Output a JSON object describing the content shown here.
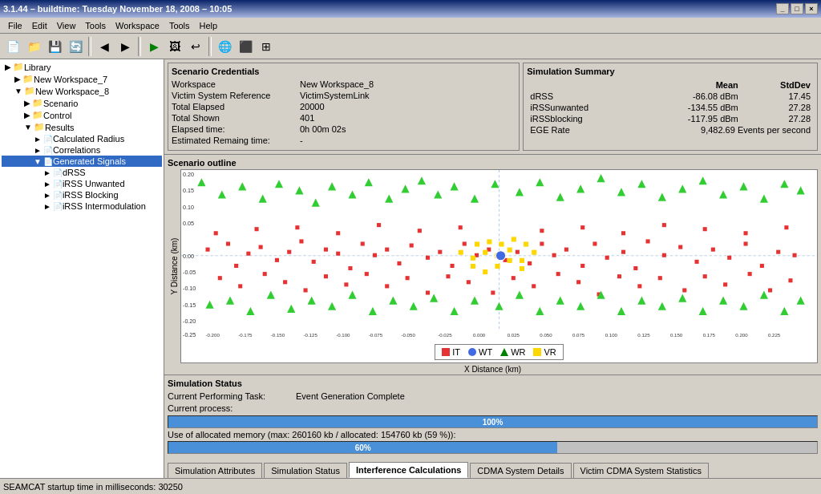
{
  "title_bar": {
    "text": "3.1.44 – buildtime: Tuesday November 18, 2008 – 10:05",
    "buttons": [
      "_",
      "□",
      "×"
    ]
  },
  "menu": {
    "items": [
      "File",
      "Edit",
      "View",
      "Tools",
      "Workspace",
      "Tools",
      "Help"
    ]
  },
  "sidebar": {
    "items": [
      {
        "label": "Library",
        "indent": 1,
        "icon": "▶",
        "type": "folder"
      },
      {
        "label": "New Workspace_7",
        "indent": 2,
        "icon": "▶",
        "type": "folder"
      },
      {
        "label": "New Workspace_8",
        "indent": 2,
        "icon": "▼",
        "type": "folder"
      },
      {
        "label": "Scenario",
        "indent": 3,
        "icon": "▶",
        "type": "folder"
      },
      {
        "label": "Control",
        "indent": 3,
        "icon": "▶",
        "type": "folder"
      },
      {
        "label": "Results",
        "indent": 3,
        "icon": "▼",
        "type": "folder"
      },
      {
        "label": "Calculated Radius",
        "indent": 4,
        "icon": "►",
        "type": "doc"
      },
      {
        "label": "Correlations",
        "indent": 4,
        "icon": "►",
        "type": "doc"
      },
      {
        "label": "Generated Signals",
        "indent": 4,
        "icon": "▼",
        "type": "doc"
      },
      {
        "label": "dRSS",
        "indent": 5,
        "icon": "►",
        "type": "doc"
      },
      {
        "label": "iRSS Unwanted",
        "indent": 5,
        "icon": "►",
        "type": "doc"
      },
      {
        "label": "iRSS Blocking",
        "indent": 5,
        "icon": "►",
        "type": "doc"
      },
      {
        "label": "iRSS Intermodulation",
        "indent": 5,
        "icon": "►",
        "type": "doc"
      }
    ]
  },
  "scenario_credentials": {
    "title": "Scenario Credentials",
    "rows": [
      {
        "label": "Workspace",
        "value": "New Workspace_8"
      },
      {
        "label": "Victim System Reference",
        "value": "VictimSystemLink"
      },
      {
        "label": "Total Elapsed",
        "value": "20000"
      },
      {
        "label": "Total Shown",
        "value": "401"
      },
      {
        "label": "Elapsed time:",
        "value": "0h 00m 02s"
      },
      {
        "label": "Estimated Remaing time:",
        "value": "-"
      }
    ]
  },
  "simulation_summary": {
    "title": "Simulation Summary",
    "headers": [
      "",
      "Mean",
      "StdDev"
    ],
    "rows": [
      {
        "label": "dRSS",
        "mean": "-86.08 dBm",
        "stddev": "17.45"
      },
      {
        "label": "iRSSunwanted",
        "mean": "-134.55 dBm",
        "stddev": "27.28"
      },
      {
        "label": "iRSSblocking",
        "mean": "-117.95 dBm",
        "stddev": "27.28"
      },
      {
        "label": "EGE Rate",
        "mean": "9,482.69 Events per second",
        "stddev": ""
      }
    ]
  },
  "scenario_outline": {
    "title": "Scenario outline",
    "x_label": "X Distance (km)",
    "y_label": "Y Distance (km)",
    "x_ticks": [
      "-0.200",
      "-0.175",
      "-0.150",
      "-0.125",
      "-0.100",
      "-0.075",
      "-0.050",
      "-0.025",
      "0.000",
      "0.025",
      "0.050",
      "0.075",
      "0.100",
      "0.125",
      "0.150",
      "0.175",
      "0.200",
      "0.225"
    ],
    "y_ticks": [
      "0.20",
      "0.15",
      "0.10",
      "0.05",
      "0.00",
      "-0.05",
      "-0.10",
      "-0.15",
      "-0.20",
      "-0.25"
    ],
    "legend": [
      {
        "symbol": "square",
        "color": "#e63232",
        "label": "IT"
      },
      {
        "symbol": "circle",
        "color": "#4169e1",
        "label": "WT"
      },
      {
        "symbol": "triangle",
        "color": "#32cd32",
        "label": "WR"
      },
      {
        "symbol": "square",
        "color": "#ffd700",
        "label": "VR"
      }
    ]
  },
  "simulation_status": {
    "title": "Simulation Status",
    "task_label": "Current Performing Task:",
    "task_value": "Event Generation Complete",
    "process_label": "Current process:",
    "progress1": {
      "label": "",
      "value": 100,
      "text": "100%"
    },
    "progress2_label": "Use of allocated memory (max: 260160 kb / allocated: 154760 kb (59 %)):",
    "progress2": {
      "value": 60,
      "text": "60%"
    }
  },
  "tabs": [
    {
      "label": "Simulation Attributes",
      "active": false
    },
    {
      "label": "Simulation Status",
      "active": false
    },
    {
      "label": "Interference Calculations",
      "active": true
    },
    {
      "label": "CDMA System Details",
      "active": false
    },
    {
      "label": "Victim CDMA System Statistics",
      "active": false
    }
  ],
  "status_bar": {
    "text": "SEAMCAT startup time in milliseconds: 30250"
  }
}
